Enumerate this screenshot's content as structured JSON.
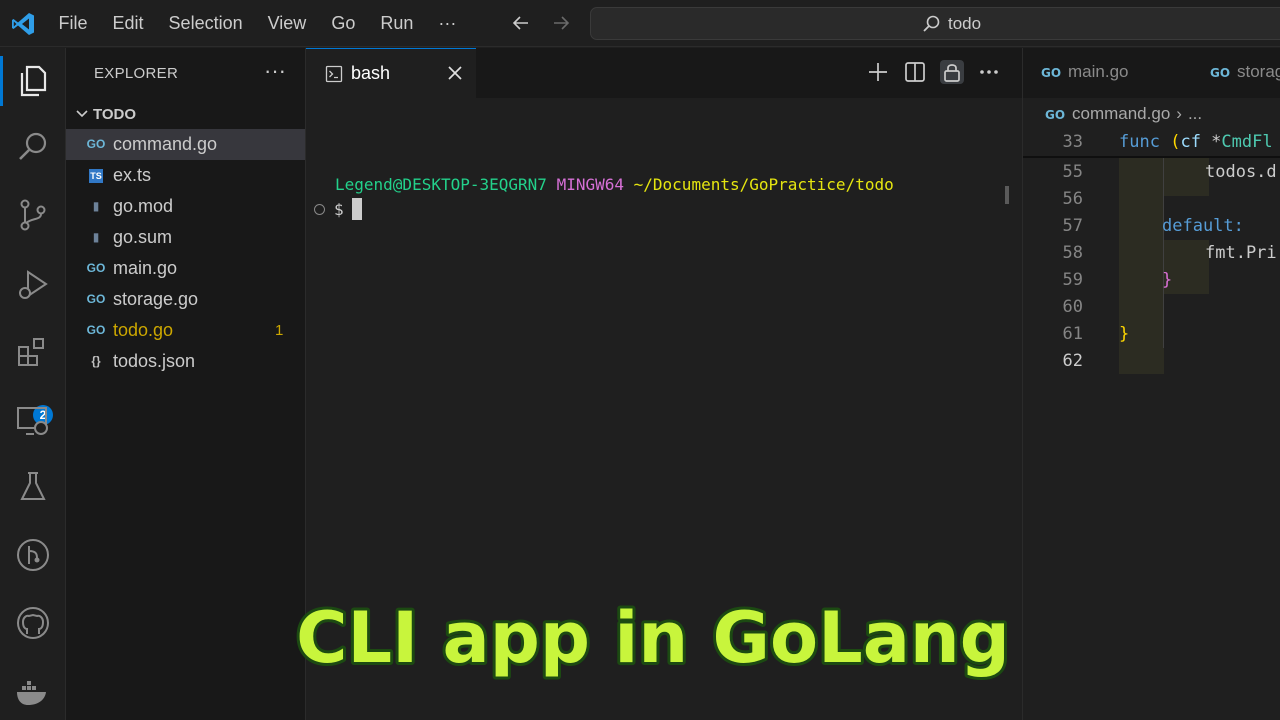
{
  "titlebar": {
    "menu": [
      "File",
      "Edit",
      "Selection",
      "View",
      "Go",
      "Run",
      "···"
    ],
    "command_center_text": "todo"
  },
  "activitybar": {
    "items": [
      "explorer-icon",
      "search-icon",
      "source-control-icon",
      "run-debug-icon",
      "extensions-icon",
      "remote-explorer-icon",
      "testing-icon",
      "git-graph-icon",
      "github-icon",
      "docker-icon"
    ],
    "extensions_badge": "2"
  },
  "sidebar": {
    "title": "EXPLORER",
    "more": "···",
    "folder": "TODO",
    "files": [
      {
        "name": "command.go",
        "icon": "go-icon",
        "selected": true,
        "modified": false,
        "badge": ""
      },
      {
        "name": "ex.ts",
        "icon": "typescript-icon",
        "selected": false,
        "modified": false,
        "badge": ""
      },
      {
        "name": "go.mod",
        "icon": "file-icon",
        "selected": false,
        "modified": false,
        "badge": ""
      },
      {
        "name": "go.sum",
        "icon": "file-icon",
        "selected": false,
        "modified": false,
        "badge": ""
      },
      {
        "name": "main.go",
        "icon": "go-icon",
        "selected": false,
        "modified": false,
        "badge": ""
      },
      {
        "name": "storage.go",
        "icon": "go-icon",
        "selected": false,
        "modified": false,
        "badge": ""
      },
      {
        "name": "todo.go",
        "icon": "go-icon",
        "selected": false,
        "modified": true,
        "badge": "1"
      },
      {
        "name": "todos.json",
        "icon": "json-icon",
        "selected": false,
        "modified": false,
        "badge": ""
      }
    ]
  },
  "terminal": {
    "tab_label": "bash",
    "prompt_user": "Legend@DESKTOP-3EQGRN7",
    "prompt_shell": "MINGW64",
    "prompt_path": "~/Documents/GoPractice/todo",
    "command_prefix": "$"
  },
  "editor": {
    "tabs": [
      "main.go",
      "storag"
    ],
    "breadcrumb_file": "command.go",
    "breadcrumb_more": "...",
    "sticky_line": {
      "number": "33",
      "text": "func (cf *CmdFl"
    },
    "lines": [
      {
        "number": "55",
        "text": "todos.d"
      },
      {
        "number": "56",
        "text": ""
      },
      {
        "number": "57",
        "text": "default:"
      },
      {
        "number": "58",
        "text": "fmt.Pri"
      },
      {
        "number": "59",
        "text": "}"
      },
      {
        "number": "60",
        "text": ""
      },
      {
        "number": "61",
        "text": "}"
      },
      {
        "number": "62",
        "text": ""
      }
    ]
  },
  "overlay": {
    "caption": "CLI app in GoLang",
    "fill_color": "#c8f53c",
    "stroke_color": "#1c4a12"
  }
}
